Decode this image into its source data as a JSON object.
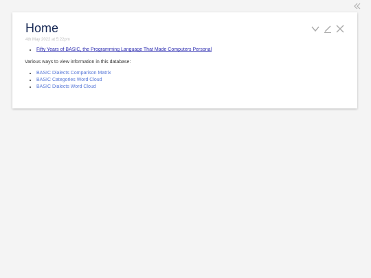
{
  "sidebar": {
    "toggle_icon": "double-chevron-left-icon"
  },
  "tiddler": {
    "title": "Home",
    "subtitle": "4th May 2022 at 5:22pm",
    "controls": {
      "fold_icon": "chevron-down-icon",
      "edit_icon": "pencil-icon",
      "close_icon": "close-icon"
    },
    "external_links": [
      {
        "label": "Fifty Years of BASIC, the Programming Language That Made Computers Personal"
      }
    ],
    "intro": "Various ways to view information in this database:",
    "view_links": [
      {
        "label": "BASIC Dialects Comparison Matrix"
      },
      {
        "label": "BASIC Categories Word Cloud"
      },
      {
        "label": "BASIC Dialects Word Cloud"
      }
    ]
  },
  "colors": {
    "title": "#182955",
    "subtitle": "#c0c0c0",
    "external_link": "#2d2db0",
    "internal_link": "#5778d8",
    "background": "#f4f4f4"
  }
}
